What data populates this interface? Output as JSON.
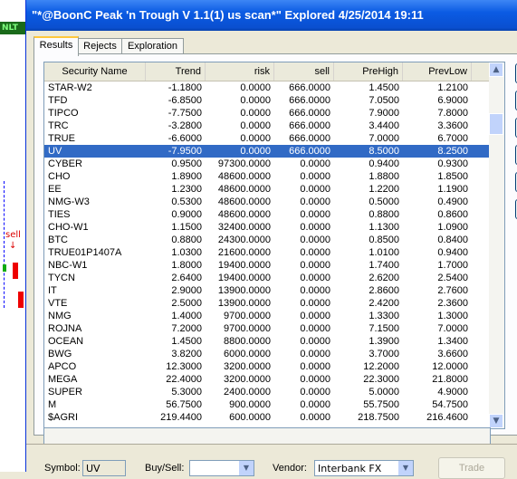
{
  "window": {
    "title": "\"*@BoonC Peak 'n Trough V 1.1(1) us scan*\" Explored 4/25/2014 19:11"
  },
  "tabs": [
    {
      "label": "Results",
      "active": true
    },
    {
      "label": "Rejects",
      "active": false
    },
    {
      "label": "Exploration",
      "active": false
    }
  ],
  "background_chart": {
    "badge": "NLT",
    "signal": "sell",
    "arrow": "↓"
  },
  "table": {
    "columns": [
      "Security Name",
      "Trend",
      "risk",
      "sell",
      "PreHigh",
      "PrevLow"
    ],
    "selected_row_index": 5,
    "rows": [
      [
        "STAR-W2",
        "-1.1800",
        "0.0000",
        "666.0000",
        "1.4500",
        "1.2100"
      ],
      [
        "TFD",
        "-6.8500",
        "0.0000",
        "666.0000",
        "7.0500",
        "6.9000"
      ],
      [
        "TIPCO",
        "-7.7500",
        "0.0000",
        "666.0000",
        "7.9000",
        "7.8000"
      ],
      [
        "TRC",
        "-3.2800",
        "0.0000",
        "666.0000",
        "3.4400",
        "3.3600"
      ],
      [
        "TRUE",
        "-6.6000",
        "0.0000",
        "666.0000",
        "7.0000",
        "6.7000"
      ],
      [
        "UV",
        "-7.9500",
        "0.0000",
        "666.0000",
        "8.5000",
        "8.2500"
      ],
      [
        "CYBER",
        "0.9500",
        "97300.0000",
        "0.0000",
        "0.9400",
        "0.9300"
      ],
      [
        "CHO",
        "1.8900",
        "48600.0000",
        "0.0000",
        "1.8800",
        "1.8500"
      ],
      [
        "EE",
        "1.2300",
        "48600.0000",
        "0.0000",
        "1.2200",
        "1.1900"
      ],
      [
        "NMG-W3",
        "0.5300",
        "48600.0000",
        "0.0000",
        "0.5000",
        "0.4900"
      ],
      [
        "TIES",
        "0.9000",
        "48600.0000",
        "0.0000",
        "0.8800",
        "0.8600"
      ],
      [
        "CHO-W1",
        "1.1500",
        "32400.0000",
        "0.0000",
        "1.1300",
        "1.0900"
      ],
      [
        "BTC",
        "0.8800",
        "24300.0000",
        "0.0000",
        "0.8500",
        "0.8400"
      ],
      [
        "TRUE01P1407A",
        "1.0300",
        "21600.0000",
        "0.0000",
        "1.0100",
        "0.9400"
      ],
      [
        "NBC-W1",
        "1.8000",
        "19400.0000",
        "0.0000",
        "1.7400",
        "1.7000"
      ],
      [
        "TYCN",
        "2.6400",
        "19400.0000",
        "0.0000",
        "2.6200",
        "2.5400"
      ],
      [
        "IT",
        "2.9000",
        "13900.0000",
        "0.0000",
        "2.8600",
        "2.7600"
      ],
      [
        "VTE",
        "2.5000",
        "13900.0000",
        "0.0000",
        "2.4200",
        "2.3600"
      ],
      [
        "NMG",
        "1.4000",
        "9700.0000",
        "0.0000",
        "1.3300",
        "1.3000"
      ],
      [
        "ROJNA",
        "7.2000",
        "9700.0000",
        "0.0000",
        "7.1500",
        "7.0000"
      ],
      [
        "OCEAN",
        "1.4500",
        "8800.0000",
        "0.0000",
        "1.3900",
        "1.3400"
      ],
      [
        "BWG",
        "3.8200",
        "6000.0000",
        "0.0000",
        "3.7000",
        "3.6600"
      ],
      [
        "APCO",
        "12.3000",
        "3200.0000",
        "0.0000",
        "12.2000",
        "12.0000"
      ],
      [
        "MEGA",
        "22.4000",
        "3200.0000",
        "0.0000",
        "22.3000",
        "21.8000"
      ],
      [
        "SUPER",
        "5.3000",
        "2400.0000",
        "0.0000",
        "5.0000",
        "4.9000"
      ],
      [
        "M",
        "56.7500",
        "900.0000",
        "0.0000",
        "55.7500",
        "54.7500"
      ],
      [
        "$AGRI",
        "219.4400",
        "600.0000",
        "0.0000",
        "218.7500",
        "216.4600"
      ]
    ]
  },
  "bottom": {
    "symbol_label": "Symbol:",
    "symbol_value": "UV",
    "buysell_label": "Buy/Sell:",
    "buysell_value": "",
    "vendor_label": "Vendor:",
    "vendor_value": "Interbank FX",
    "trade_label": "Trade"
  },
  "colors": {
    "selection": "#316ac5",
    "titlebar": "#0b5be3"
  }
}
